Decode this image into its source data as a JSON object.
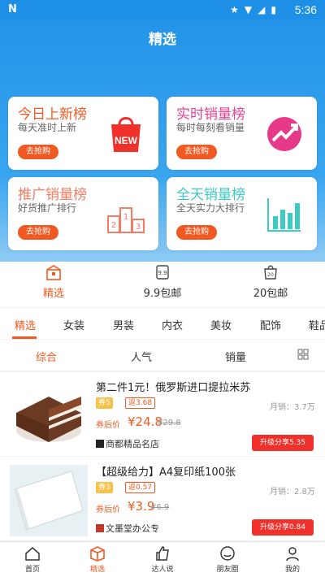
{
  "status": {
    "time": "5:36",
    "left": "N"
  },
  "header": {
    "title": "精选"
  },
  "cards": [
    {
      "title": "今日上新榜",
      "subtitle": "每天准时上新",
      "button": "去抢购",
      "title_color": "#f05a22",
      "icon": "new-bag-icon"
    },
    {
      "title": "实时销量榜",
      "subtitle": "每时每刻看销量",
      "button": "去抢购",
      "title_color": "#e84393",
      "icon": "trend-up-icon"
    },
    {
      "title": "推广销量榜",
      "subtitle": "好货推广排行",
      "button": "去抢购",
      "title_color": "#f57c64",
      "icon": "podium-icon"
    },
    {
      "title": "全天销量榜",
      "subtitle": "全天实力大排行",
      "button": "去抢购",
      "title_color": "#3ec9c1",
      "icon": "bar-chart-icon"
    }
  ],
  "categories": [
    {
      "label": "精选",
      "icon": "gift-box-icon"
    },
    {
      "label": "9.9包邮",
      "icon": "tag-99-icon"
    },
    {
      "label": "20包邮",
      "icon": "bag-20-icon"
    }
  ],
  "tabs": [
    "精选",
    "女装",
    "男装",
    "内衣",
    "美妆",
    "配饰",
    "鞋品"
  ],
  "sorts": [
    "综合",
    "人气",
    "销量"
  ],
  "products": [
    {
      "title": "第二件1元！俄罗斯进口提拉米苏",
      "coupon": "券5",
      "rebate": "返3.68",
      "price_label": "券后价",
      "price": "¥24.8",
      "orig_price": "¥29.8",
      "monthly": "月销：3.7万",
      "shop": "商都精品名店",
      "share": "升级分享5.35"
    },
    {
      "title": "【超级给力】A4复印纸100张",
      "coupon": "券3",
      "rebate": "返0.57",
      "price_label": "券后价",
      "price": "¥3.9",
      "orig_price": "¥6.9",
      "monthly": "月销：2.8万",
      "shop": "文墨堂办公专",
      "share": "升级分享0.84"
    }
  ],
  "nav": [
    "首页",
    "精选",
    "达人说",
    "朋友圈",
    "我的"
  ],
  "colors": {
    "accent": "#f05a22",
    "header_blue": "#2394e8"
  }
}
